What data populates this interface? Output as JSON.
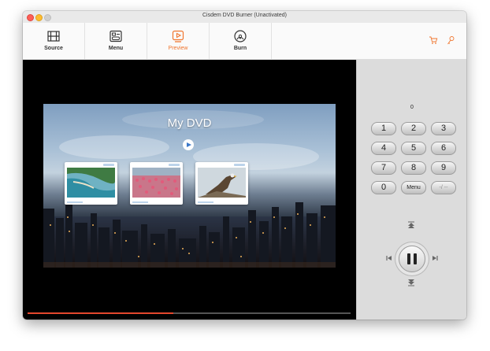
{
  "window": {
    "title": "Cisdem DVD Burner (Unactivated)"
  },
  "toolbar": {
    "tabs": [
      {
        "label": "Source",
        "icon": "film-icon"
      },
      {
        "label": "Menu",
        "icon": "menu-icon"
      },
      {
        "label": "Preview",
        "icon": "play-icon"
      },
      {
        "label": "Burn",
        "icon": "disc-icon"
      }
    ],
    "active_tab": "Preview",
    "accent_color": "#f0762f",
    "right_icons": [
      "cart-icon",
      "key-icon"
    ]
  },
  "preview": {
    "menu_title": "My DVD",
    "thumbnails": [
      "coast-thumbnail",
      "flamingo-thumbnail",
      "eagle-thumbnail"
    ],
    "progress": 0.45,
    "progress_color": "#e5472d"
  },
  "remote": {
    "display": "0",
    "keys": [
      "1",
      "2",
      "3",
      "4",
      "5",
      "6",
      "7",
      "8",
      "9",
      "0",
      "Menu",
      "-/ --"
    ]
  }
}
